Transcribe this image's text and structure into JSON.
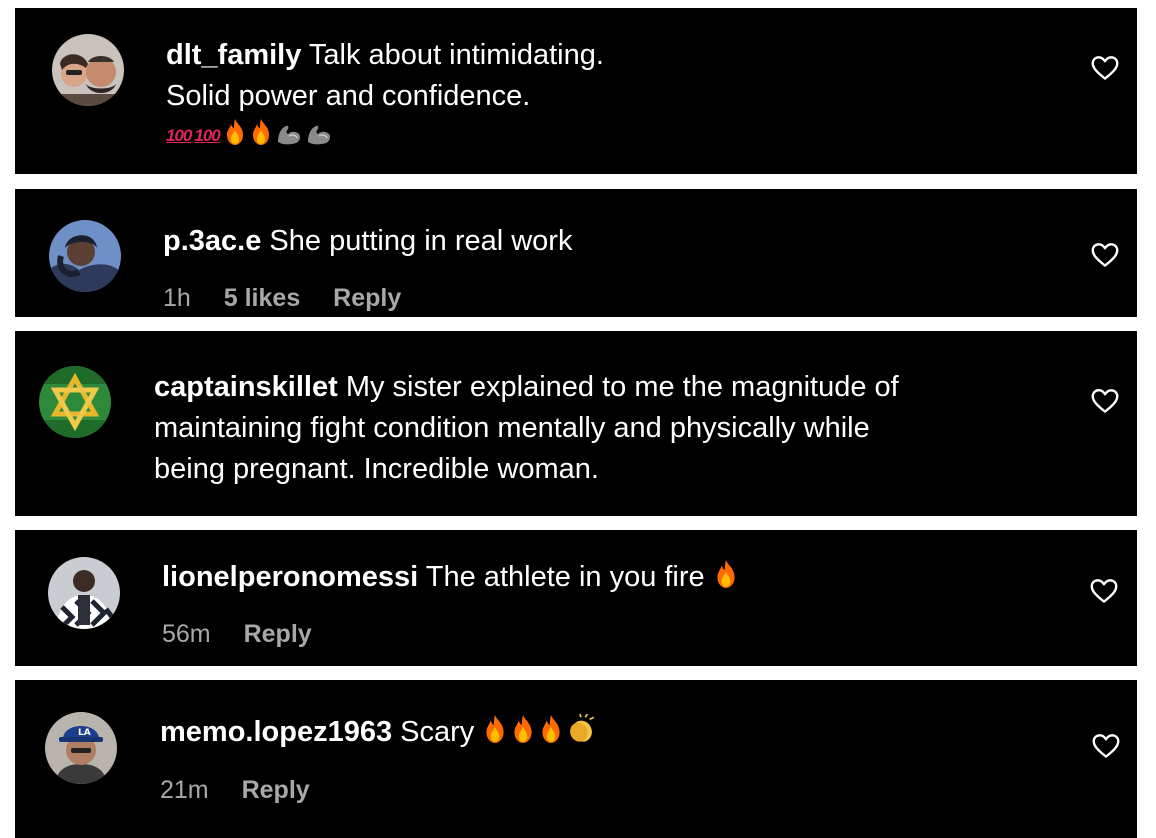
{
  "comments": [
    {
      "username": "dlt_family",
      "text_line1": "Talk about intimidating.",
      "text_line2": "Solid power and confidence.",
      "emojis": [
        "100-emoji",
        "100-emoji",
        "fire-emoji",
        "fire-emoji",
        "flexed-biceps-emoji",
        "flexed-biceps-emoji"
      ],
      "hundred_label": "100",
      "avatar": "couple-selfie"
    },
    {
      "username": "p.3ac.e",
      "text": "She putting in real work",
      "time": "1h",
      "likes": "5 likes",
      "reply": "Reply",
      "avatar": "person-hood"
    },
    {
      "username": "captainskillet",
      "text_line1": "My sister explained to me the magnitude of",
      "text_line2": "maintaining fight condition mentally and physically while",
      "text_line3": "being pregnant. Incredible woman.",
      "avatar": "gold-star-on-green"
    },
    {
      "username": "lionelperonomessi",
      "text": "The athlete in you fire",
      "emojis": [
        "fire-emoji"
      ],
      "time": "56m",
      "reply": "Reply",
      "avatar": "man-checkered-jacket"
    },
    {
      "username": "memo.lopez1963",
      "text": "Scary",
      "emojis": [
        "fire-emoji",
        "fire-emoji",
        "fire-emoji",
        "clapping-hands-emoji"
      ],
      "time": "21m",
      "reply": "Reply",
      "avatar": "man-blue-cap"
    }
  ],
  "colors": {
    "card_background": "#000000",
    "page_background": "#ffffff",
    "text_primary": "#ffffff",
    "text_secondary": "#a8a8a8",
    "emoji_100": "#e0245e"
  }
}
